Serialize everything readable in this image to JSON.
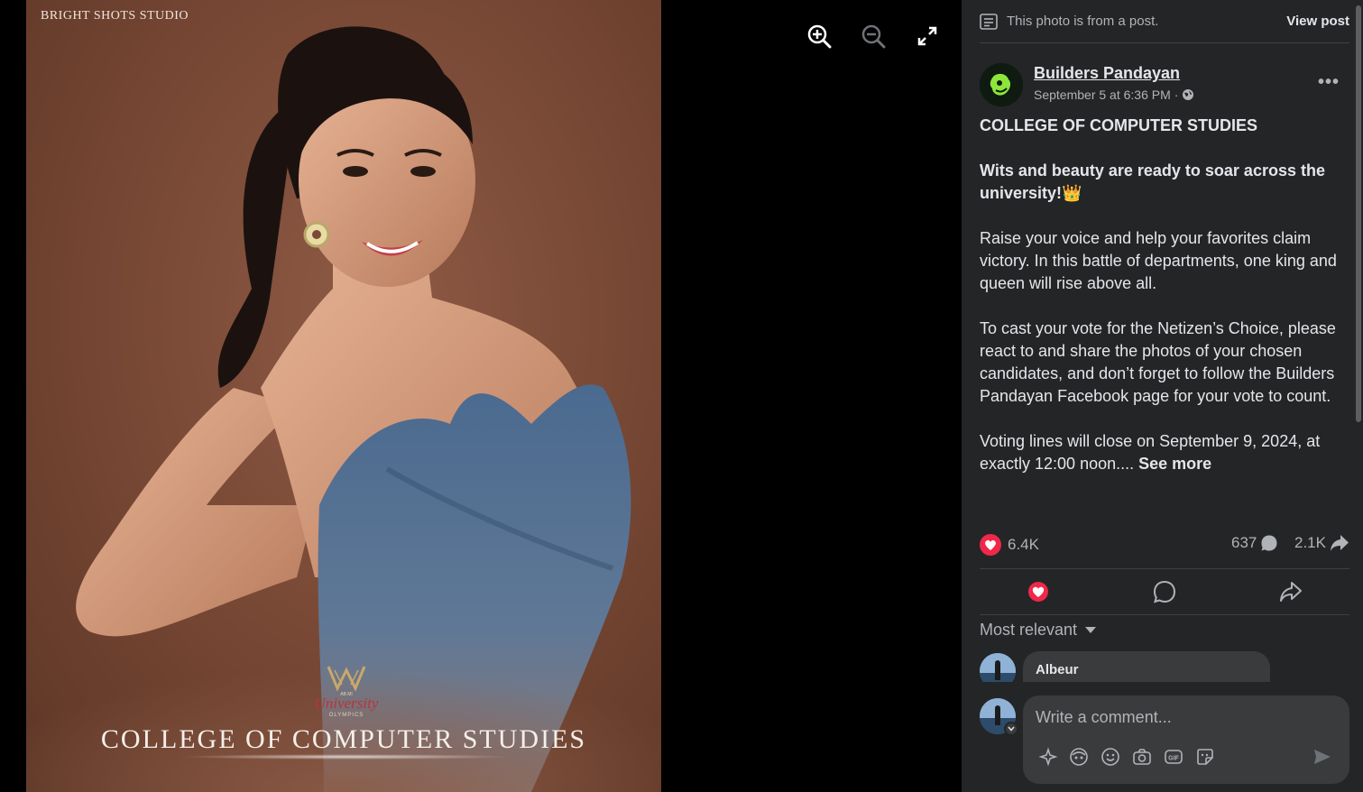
{
  "photo": {
    "watermark": "BRIGHT SHOTS STUDIO",
    "logo_text": "University",
    "logo_subtext": "OLYMPICS",
    "logo_top": "AB MI",
    "caption": "COLLEGE OF COMPUTER STUDIES"
  },
  "toolbar": {
    "zoom_in_icon": "zoom-in-icon",
    "zoom_out_icon": "zoom-out-icon",
    "fullscreen_icon": "fullscreen-icon"
  },
  "post_bar": {
    "text": "This photo is from a post.",
    "view_post": "View post"
  },
  "post": {
    "author": "Builders Pandayan",
    "timestamp": "September 5 at 6:36 PM",
    "separator": "·",
    "more": "•••",
    "heading": "COLLEGE OF COMPUTER STUDIES",
    "tagline": "Wits and beauty are ready to soar across the university!",
    "tagline_emoji": "👑",
    "para1": "Raise your voice and help your favorites claim victory. In this battle of departments, one king and queen will rise above all.",
    "para2": "To cast your vote for the Netizen’s Choice, please react to and share the photos of your chosen candidates, and don’t forget to follow the Builders Pandayan Facebook page for your vote to count.",
    "para3": "Voting lines will close on September 9, 2024, at exactly 12:00 noon....",
    "see_more": "See more"
  },
  "stats": {
    "reactions": "6.4K",
    "comments": "637",
    "shares": "2.1K"
  },
  "sort": {
    "label": "Most relevant"
  },
  "comments": [
    {
      "name": "Albeur"
    }
  ],
  "composer": {
    "placeholder": "Write a comment..."
  },
  "colors": {
    "panel_bg": "#242526",
    "accent_heart": "#f0284a",
    "text_primary": "#e4e6eb",
    "text_secondary": "#b0b3b8"
  }
}
